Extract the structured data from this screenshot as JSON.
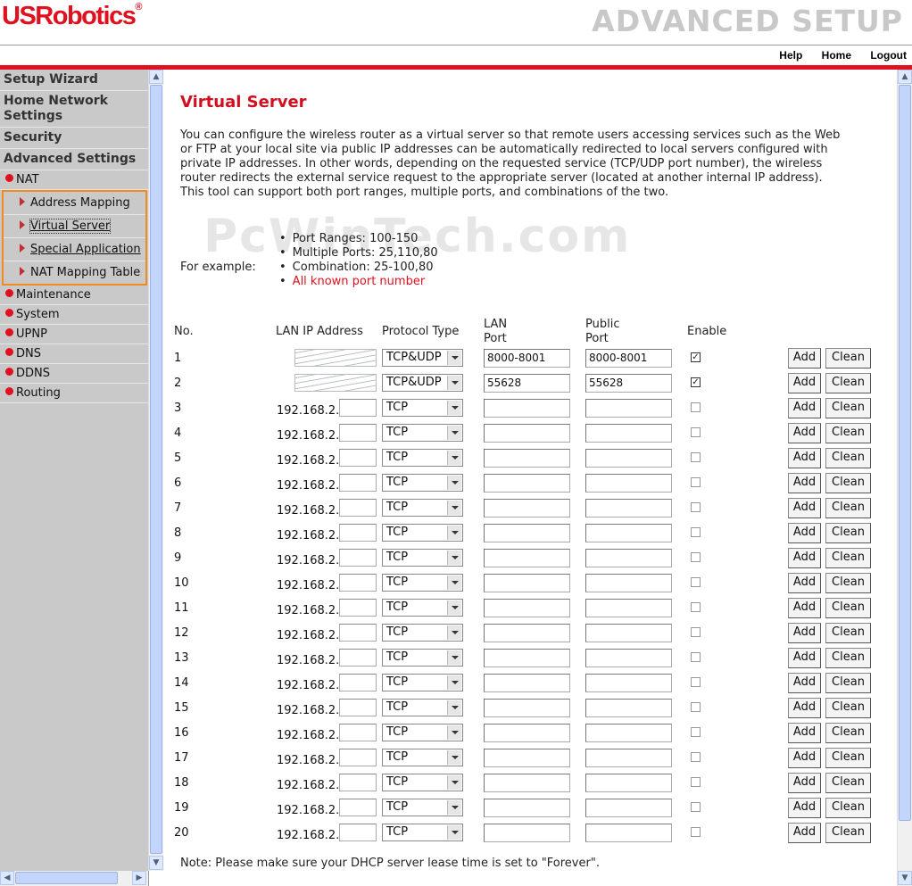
{
  "header": {
    "logo": "USRobotics",
    "logo_mark": "®",
    "banner": "ADVANCED SETUP",
    "links": [
      "Help",
      "Home",
      "Logout"
    ]
  },
  "sidebar": {
    "headings": [
      "Setup Wizard",
      "Home Network Settings",
      "Security",
      "Advanced Settings"
    ],
    "nat_label": "NAT",
    "nat_items": [
      "Address Mapping",
      "Virtual Server",
      "Special Application",
      "NAT Mapping Table"
    ],
    "other_items": [
      "Maintenance",
      "System",
      "UPNP",
      "DNS",
      "DDNS",
      "Routing"
    ]
  },
  "page": {
    "title": "Virtual Server",
    "description": "You can configure the wireless router as a virtual server so that remote users accessing services such as the Web or FTP at your local site via public IP addresses can be automatically redirected to local servers configured with private IP addresses. In other words, depending on the requested service (TCP/UDP port number), the wireless router redirects the external service request to the appropriate server (located at another internal IP address). This tool can support both port ranges, multiple ports, and combinations of the two.",
    "watermark": "PcWinTech.com",
    "example_label": "For example:",
    "examples": [
      "Port Ranges: 100-150",
      "Multiple Ports: 25,110,80",
      "Combination: 25-100,80"
    ],
    "known_ports_link": "All known port number",
    "note": "Note: Please make sure your DHCP server lease time is set to \"Forever\"."
  },
  "table": {
    "headers": {
      "no": "No.",
      "lan_ip": "LAN IP Address",
      "protocol": "Protocol Type",
      "lan_port_1": "LAN",
      "lan_port_2": "Port",
      "public_port_1": "Public",
      "public_port_2": "Port",
      "enable": "Enable"
    },
    "ip_prefix": "192.168.2.",
    "add_label": "Add",
    "clean_label": "Clean",
    "rows": [
      {
        "no": "1",
        "protocol": "TCP&UDP",
        "lan_port": "8000-8001",
        "public_port": "8000-8001",
        "enabled": true,
        "blurred_ip": true
      },
      {
        "no": "2",
        "protocol": "TCP&UDP",
        "lan_port": "55628",
        "public_port": "55628",
        "enabled": true,
        "blurred_ip": true
      },
      {
        "no": "3",
        "protocol": "TCP",
        "lan_port": "",
        "public_port": "",
        "enabled": false
      },
      {
        "no": "4",
        "protocol": "TCP",
        "lan_port": "",
        "public_port": "",
        "enabled": false
      },
      {
        "no": "5",
        "protocol": "TCP",
        "lan_port": "",
        "public_port": "",
        "enabled": false
      },
      {
        "no": "6",
        "protocol": "TCP",
        "lan_port": "",
        "public_port": "",
        "enabled": false
      },
      {
        "no": "7",
        "protocol": "TCP",
        "lan_port": "",
        "public_port": "",
        "enabled": false
      },
      {
        "no": "8",
        "protocol": "TCP",
        "lan_port": "",
        "public_port": "",
        "enabled": false
      },
      {
        "no": "9",
        "protocol": "TCP",
        "lan_port": "",
        "public_port": "",
        "enabled": false
      },
      {
        "no": "10",
        "protocol": "TCP",
        "lan_port": "",
        "public_port": "",
        "enabled": false
      },
      {
        "no": "11",
        "protocol": "TCP",
        "lan_port": "",
        "public_port": "",
        "enabled": false
      },
      {
        "no": "12",
        "protocol": "TCP",
        "lan_port": "",
        "public_port": "",
        "enabled": false
      },
      {
        "no": "13",
        "protocol": "TCP",
        "lan_port": "",
        "public_port": "",
        "enabled": false
      },
      {
        "no": "14",
        "protocol": "TCP",
        "lan_port": "",
        "public_port": "",
        "enabled": false
      },
      {
        "no": "15",
        "protocol": "TCP",
        "lan_port": "",
        "public_port": "",
        "enabled": false
      },
      {
        "no": "16",
        "protocol": "TCP",
        "lan_port": "",
        "public_port": "",
        "enabled": false
      },
      {
        "no": "17",
        "protocol": "TCP",
        "lan_port": "",
        "public_port": "",
        "enabled": false
      },
      {
        "no": "18",
        "protocol": "TCP",
        "lan_port": "",
        "public_port": "",
        "enabled": false
      },
      {
        "no": "19",
        "protocol": "TCP",
        "lan_port": "",
        "public_port": "",
        "enabled": false
      },
      {
        "no": "20",
        "protocol": "TCP",
        "lan_port": "",
        "public_port": "",
        "enabled": false
      }
    ]
  },
  "colors": {
    "brand_red": "#e0101e",
    "banner_gray": "#c8c8c8",
    "sidebar_bg": "#c9c9c9",
    "nat_outline": "#f08c1c"
  }
}
